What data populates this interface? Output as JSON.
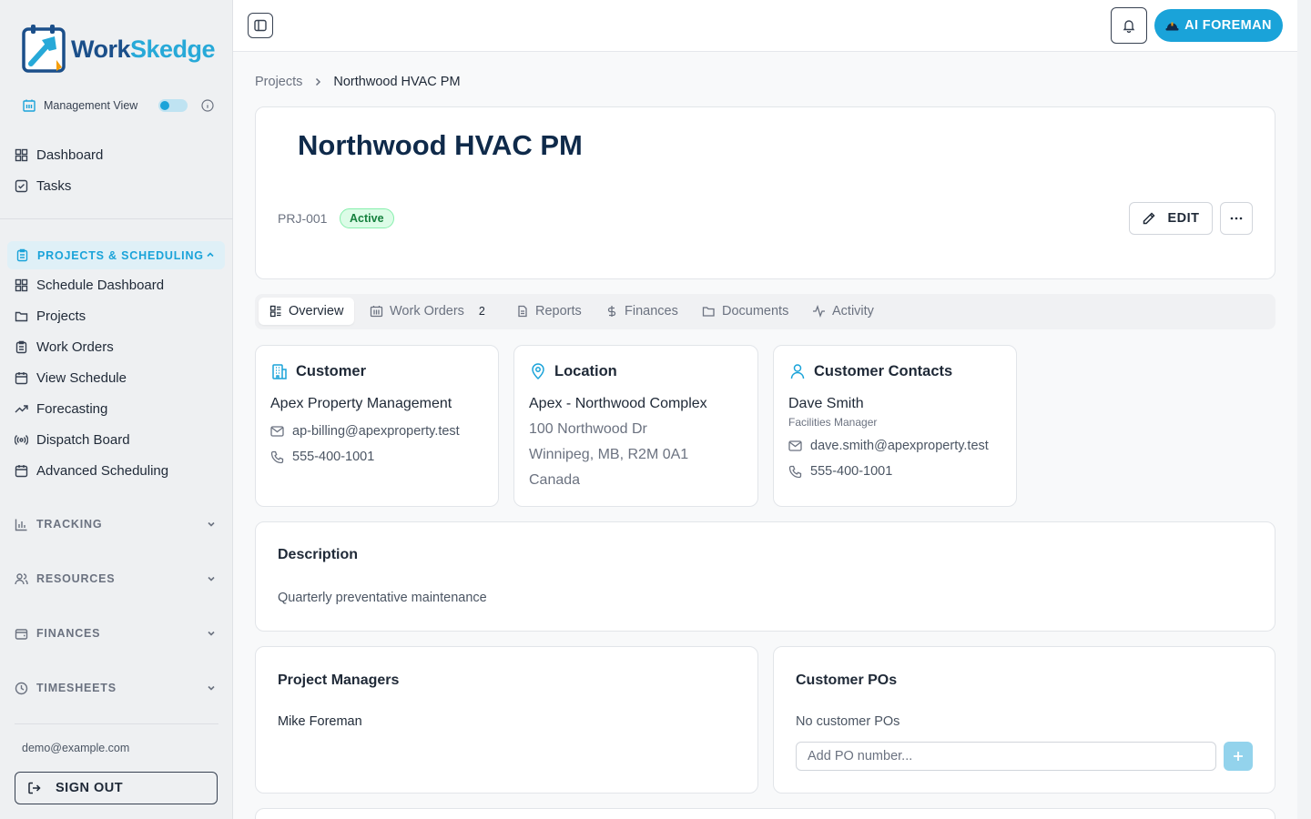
{
  "brand": {
    "name_part1": "Work",
    "name_part2": "Skedge"
  },
  "management_view": {
    "label": "Management View",
    "enabled": true
  },
  "nav_top": [
    {
      "label": "Dashboard",
      "icon": "dashboard-icon"
    },
    {
      "label": "Tasks",
      "icon": "tasks-icon"
    }
  ],
  "sections": {
    "projects_scheduling": {
      "label": "PROJECTS & SCHEDULING",
      "expanded": true,
      "items": [
        {
          "label": "Schedule Dashboard",
          "icon": "dashboard-icon"
        },
        {
          "label": "Projects",
          "icon": "folder-icon"
        },
        {
          "label": "Work Orders",
          "icon": "clipboard-icon"
        },
        {
          "label": "View Schedule",
          "icon": "calendar-icon"
        },
        {
          "label": "Forecasting",
          "icon": "trending-up-icon"
        },
        {
          "label": "Dispatch Board",
          "icon": "broadcast-icon"
        },
        {
          "label": "Advanced Scheduling",
          "icon": "calendar-icon"
        }
      ]
    },
    "tracking": {
      "label": "TRACKING",
      "expanded": false
    },
    "resources": {
      "label": "RESOURCES",
      "expanded": false
    },
    "finances": {
      "label": "FINANCES",
      "expanded": false
    },
    "timesheets": {
      "label": "TIMESHEETS",
      "expanded": false
    }
  },
  "user": {
    "email": "demo@example.com",
    "signout_label": "SIGN OUT"
  },
  "topbar": {
    "ai_label": "AI FOREMAN"
  },
  "breadcrumb": {
    "parent": "Projects",
    "current": "Northwood HVAC PM"
  },
  "project": {
    "title": "Northwood HVAC PM",
    "id": "PRJ-001",
    "status": "Active",
    "edit_label": "EDIT"
  },
  "tabs": [
    {
      "label": "Overview",
      "active": true
    },
    {
      "label": "Work Orders",
      "count": "2"
    },
    {
      "label": "Reports"
    },
    {
      "label": "Finances"
    },
    {
      "label": "Documents"
    },
    {
      "label": "Activity"
    }
  ],
  "customer": {
    "title": "Customer",
    "name": "Apex Property Management",
    "email": "ap-billing@apexproperty.test",
    "phone": "555-400-1001"
  },
  "location": {
    "title": "Location",
    "name": "Apex - Northwood Complex",
    "line1": "100 Northwood Dr",
    "line2": "Winnipeg, MB, R2M 0A1",
    "line3": "Canada"
  },
  "contacts": {
    "title": "Customer Contacts",
    "name": "Dave Smith",
    "role": "Facilities Manager",
    "email": "dave.smith@apexproperty.test",
    "phone": "555-400-1001"
  },
  "description": {
    "title": "Description",
    "text": "Quarterly preventative maintenance"
  },
  "project_managers": {
    "title": "Project Managers",
    "names": [
      "Mike Foreman"
    ]
  },
  "customer_pos": {
    "title": "Customer POs",
    "empty_text": "No customer POs",
    "placeholder": "Add PO number..."
  },
  "colors": {
    "accent": "#1aa3d9",
    "title_navy": "#0f2a4a",
    "status_green": "#15803d"
  }
}
